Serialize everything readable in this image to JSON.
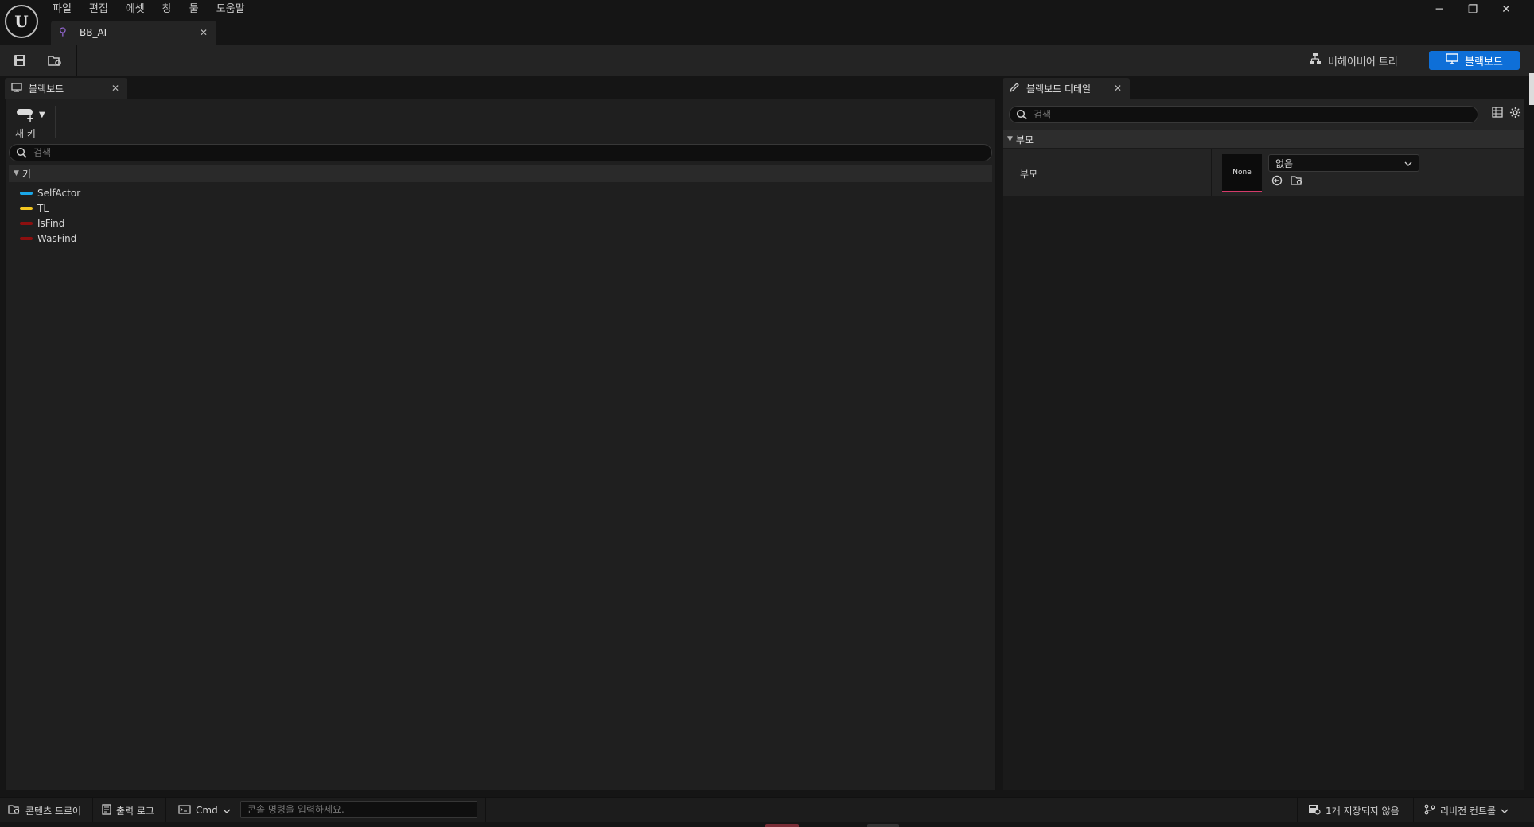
{
  "menu": [
    "파일",
    "편집",
    "에셋",
    "창",
    "툴",
    "도움말"
  ],
  "document_tab": {
    "label": "BB_AI",
    "close": "✕"
  },
  "window": {
    "minimize": "─",
    "restore": "❐",
    "close": "✕"
  },
  "toolbar": {
    "modes": {
      "behavior_tree": "비헤이비어 트리",
      "blackboard": "블랙보드"
    }
  },
  "left_panel": {
    "tab_label": "블랙보드",
    "new_key_label": "새 키",
    "search_placeholder": "검색",
    "category": "키",
    "keys": [
      {
        "name": "SelfActor",
        "color": "#1aa7e8"
      },
      {
        "name": "TL",
        "color": "#f3c620"
      },
      {
        "name": "IsFind",
        "color": "#8d0f0f"
      },
      {
        "name": "WasFind",
        "color": "#8d0f0f"
      }
    ]
  },
  "right_panel": {
    "tab_label": "블랙보드 디테일",
    "search_placeholder": "검색",
    "category": "부모",
    "row_label": "부모",
    "thumbnail_text": "None",
    "combo_value": "없음"
  },
  "statusbar": {
    "content_drawer": "콘텐츠 드로어",
    "output_log": "출력 로그",
    "cmd": "Cmd",
    "cmd_placeholder": "콘솔 명령을 입력하세요.",
    "unsaved": "1개 저장되지 않음",
    "revision_control": "리비전 컨트롤"
  },
  "colors": {
    "accent": "#0e6fd8",
    "thumbnail_underline": "#d43b6a"
  }
}
